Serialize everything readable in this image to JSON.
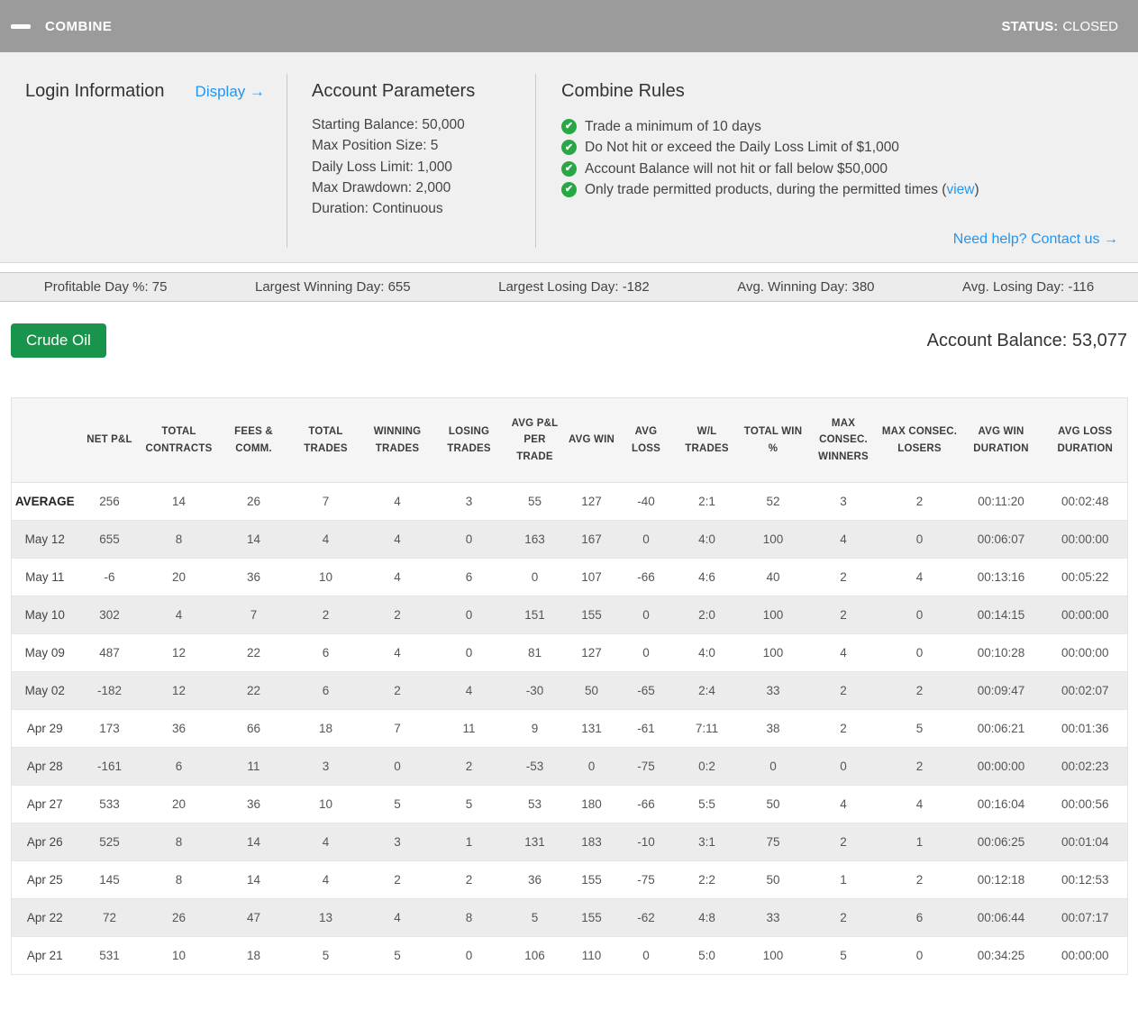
{
  "header": {
    "title": "COMBINE",
    "status_label": "STATUS:",
    "status_value": "CLOSED"
  },
  "info": {
    "login": {
      "title": "Login Information",
      "display_link": "Display →"
    },
    "account_parameters": {
      "title": "Account Parameters",
      "items": [
        "Starting Balance: 50,000",
        "Max Position Size: 5",
        "Daily Loss Limit: 1,000",
        "Max Drawdown: 2,000",
        "Duration: Continuous"
      ]
    },
    "combine_rules": {
      "title": "Combine Rules",
      "rules": [
        {
          "text": "Trade a minimum of 10 days",
          "link": "",
          "suffix": ""
        },
        {
          "text": "Do Not hit or exceed the Daily Loss Limit of $1,000",
          "link": "",
          "suffix": ""
        },
        {
          "text": "Account Balance will not hit or fall below $50,000",
          "link": "",
          "suffix": ""
        },
        {
          "text": "Only trade permitted products, during the permitted times (",
          "link": "view",
          "suffix": ")"
        }
      ]
    },
    "help_link": "Need help? Contact us →"
  },
  "stats": [
    {
      "label": "Profitable Day %",
      "value": "75"
    },
    {
      "label": "Largest Winning Day",
      "value": "655"
    },
    {
      "label": "Largest Losing Day",
      "value": "-182"
    },
    {
      "label": "Avg. Winning Day",
      "value": "380"
    },
    {
      "label": "Avg. Losing Day",
      "value": "-116"
    }
  ],
  "account": {
    "product_button": "Crude Oil",
    "balance_label": "Account Balance:",
    "balance_value": "53,077"
  },
  "colors": {
    "titlebar_gray": "#9b9b9b",
    "link_blue": "#2196f3",
    "check_green": "#27a845",
    "button_green": "#18944c"
  },
  "table": {
    "columns": [
      {
        "id": "row-label",
        "label": ""
      },
      {
        "id": "net-pl",
        "label": "NET P&L"
      },
      {
        "id": "total-contracts",
        "label": "TOTAL CONTRACTS"
      },
      {
        "id": "fees-comm",
        "label": "FEES & COMM."
      },
      {
        "id": "total-trades",
        "label": "TOTAL TRADES"
      },
      {
        "id": "winning-trades",
        "label": "WINNING TRADES"
      },
      {
        "id": "losing-trades",
        "label": "LOSING TRADES"
      },
      {
        "id": "avg-pl-per-trade",
        "label": "AVG P&L PER TRADE"
      },
      {
        "id": "avg-win",
        "label": "AVG WIN"
      },
      {
        "id": "avg-loss",
        "label": "AVG LOSS"
      },
      {
        "id": "wl-trades",
        "label": "W/L TRADES"
      },
      {
        "id": "total-win-pct",
        "label": "TOTAL WIN %"
      },
      {
        "id": "max-consec-winners",
        "label": "MAX CONSEC. WINNERS"
      },
      {
        "id": "max-consec-losers",
        "label": "MAX CONSEC. LOSERS"
      },
      {
        "id": "avg-win-duration",
        "label": "AVG WIN DURATION"
      },
      {
        "id": "avg-loss-duration",
        "label": "AVG LOSS DURATION"
      }
    ],
    "rows": [
      {
        "label": "AVERAGE",
        "is_summary": true,
        "cells": [
          "256",
          "14",
          "26",
          "7",
          "4",
          "3",
          "55",
          "127",
          "-40",
          "2:1",
          "52",
          "3",
          "2",
          "00:11:20",
          "00:02:48"
        ]
      },
      {
        "label": "May 12",
        "is_summary": false,
        "cells": [
          "655",
          "8",
          "14",
          "4",
          "4",
          "0",
          "163",
          "167",
          "0",
          "4:0",
          "100",
          "4",
          "0",
          "00:06:07",
          "00:00:00"
        ]
      },
      {
        "label": "May 11",
        "is_summary": false,
        "cells": [
          "-6",
          "20",
          "36",
          "10",
          "4",
          "6",
          "0",
          "107",
          "-66",
          "4:6",
          "40",
          "2",
          "4",
          "00:13:16",
          "00:05:22"
        ]
      },
      {
        "label": "May 10",
        "is_summary": false,
        "cells": [
          "302",
          "4",
          "7",
          "2",
          "2",
          "0",
          "151",
          "155",
          "0",
          "2:0",
          "100",
          "2",
          "0",
          "00:14:15",
          "00:00:00"
        ]
      },
      {
        "label": "May 09",
        "is_summary": false,
        "cells": [
          "487",
          "12",
          "22",
          "6",
          "4",
          "0",
          "81",
          "127",
          "0",
          "4:0",
          "100",
          "4",
          "0",
          "00:10:28",
          "00:00:00"
        ]
      },
      {
        "label": "May 02",
        "is_summary": false,
        "cells": [
          "-182",
          "12",
          "22",
          "6",
          "2",
          "4",
          "-30",
          "50",
          "-65",
          "2:4",
          "33",
          "2",
          "2",
          "00:09:47",
          "00:02:07"
        ]
      },
      {
        "label": "Apr 29",
        "is_summary": false,
        "cells": [
          "173",
          "36",
          "66",
          "18",
          "7",
          "11",
          "9",
          "131",
          "-61",
          "7:11",
          "38",
          "2",
          "5",
          "00:06:21",
          "00:01:36"
        ]
      },
      {
        "label": "Apr 28",
        "is_summary": false,
        "cells": [
          "-161",
          "6",
          "11",
          "3",
          "0",
          "2",
          "-53",
          "0",
          "-75",
          "0:2",
          "0",
          "0",
          "2",
          "00:00:00",
          "00:02:23"
        ]
      },
      {
        "label": "Apr 27",
        "is_summary": false,
        "cells": [
          "533",
          "20",
          "36",
          "10",
          "5",
          "5",
          "53",
          "180",
          "-66",
          "5:5",
          "50",
          "4",
          "4",
          "00:16:04",
          "00:00:56"
        ]
      },
      {
        "label": "Apr 26",
        "is_summary": false,
        "cells": [
          "525",
          "8",
          "14",
          "4",
          "3",
          "1",
          "131",
          "183",
          "-10",
          "3:1",
          "75",
          "2",
          "1",
          "00:06:25",
          "00:01:04"
        ]
      },
      {
        "label": "Apr 25",
        "is_summary": false,
        "cells": [
          "145",
          "8",
          "14",
          "4",
          "2",
          "2",
          "36",
          "155",
          "-75",
          "2:2",
          "50",
          "1",
          "2",
          "00:12:18",
          "00:12:53"
        ]
      },
      {
        "label": "Apr 22",
        "is_summary": false,
        "cells": [
          "72",
          "26",
          "47",
          "13",
          "4",
          "8",
          "5",
          "155",
          "-62",
          "4:8",
          "33",
          "2",
          "6",
          "00:06:44",
          "00:07:17"
        ]
      },
      {
        "label": "Apr 21",
        "is_summary": false,
        "cells": [
          "531",
          "10",
          "18",
          "5",
          "5",
          "0",
          "106",
          "110",
          "0",
          "5:0",
          "100",
          "5",
          "0",
          "00:34:25",
          "00:00:00"
        ]
      }
    ]
  }
}
